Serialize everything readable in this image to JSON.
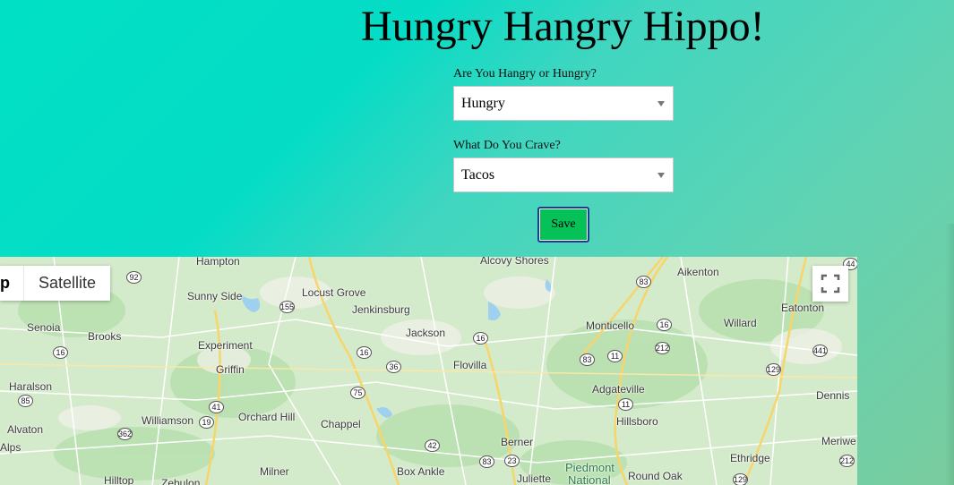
{
  "header": {
    "title": "Hungry Hangry Hippo!"
  },
  "form": {
    "mood_label": "Are You Hangry or Hungry?",
    "mood_value": "Hungry",
    "crave_label": "What Do You Crave?",
    "crave_value": "Tacos",
    "save_label": "Save"
  },
  "map": {
    "type_control": {
      "map_label": "p",
      "satellite_label": "Satellite"
    },
    "places": [
      {
        "name": "Hampton"
      },
      {
        "name": "Alcovy Shores"
      },
      {
        "name": "Aikenton"
      },
      {
        "name": "Sunny Side"
      },
      {
        "name": "Locust Grove"
      },
      {
        "name": "Eatonton"
      },
      {
        "name": "Jenkinsburg"
      },
      {
        "name": "Senoia"
      },
      {
        "name": "Monticello"
      },
      {
        "name": "Willard"
      },
      {
        "name": "Brooks"
      },
      {
        "name": "Jackson"
      },
      {
        "name": "Experiment"
      },
      {
        "name": "Griffin"
      },
      {
        "name": "Flovilla"
      },
      {
        "name": "Haralson"
      },
      {
        "name": "Adgateville"
      },
      {
        "name": "Dennis"
      },
      {
        "name": "Williamson"
      },
      {
        "name": "Orchard Hill"
      },
      {
        "name": "Hillsboro"
      },
      {
        "name": "Alvaton"
      },
      {
        "name": "Chappel"
      },
      {
        "name": "Berner"
      },
      {
        "name": "Meriwe"
      },
      {
        "name": "Alps"
      },
      {
        "name": "Ethridge"
      },
      {
        "name": "Milner"
      },
      {
        "name": "Box Ankle"
      },
      {
        "name": "Round Oak"
      },
      {
        "name": "Hilltop"
      },
      {
        "name": "Zebulon"
      },
      {
        "name": "Juliette"
      }
    ],
    "park": {
      "line1": "Piedmont",
      "line2": "National"
    },
    "shields": [
      "44",
      "92",
      "83",
      "155",
      "16",
      "16",
      "16",
      "212",
      "36",
      "16",
      "129",
      "441",
      "85",
      "83",
      "11",
      "75",
      "41",
      "19",
      "11",
      "362",
      "42",
      "83",
      "23",
      "212",
      "129"
    ]
  }
}
